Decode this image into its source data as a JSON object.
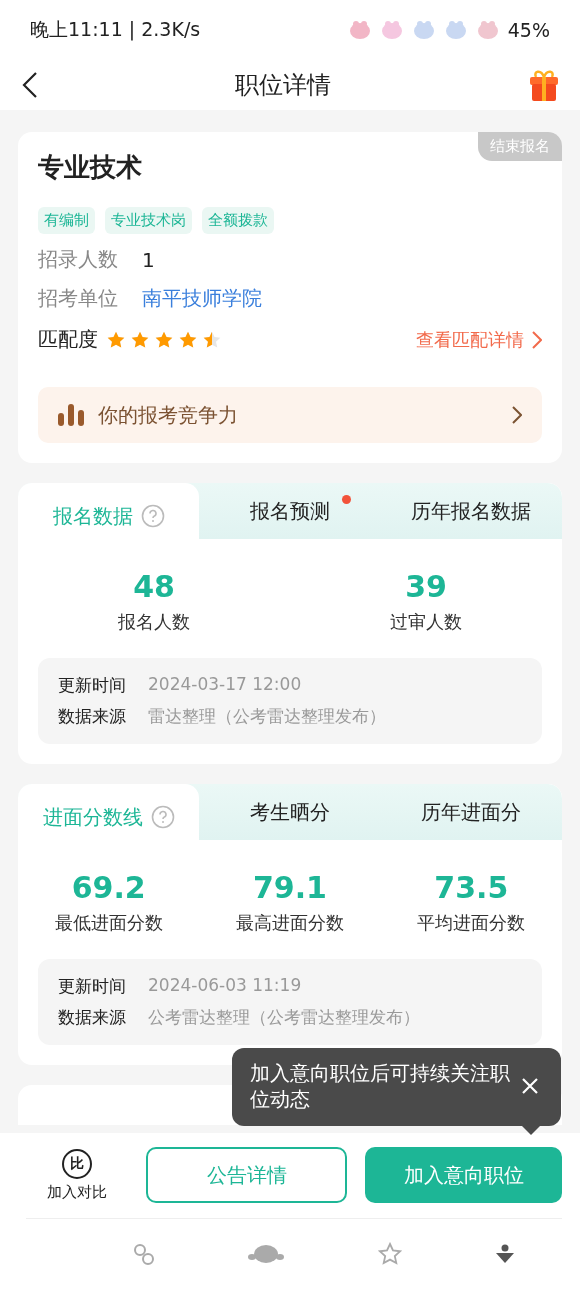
{
  "status_bar": {
    "time": "晚上11:11 | 2.3K/s",
    "battery": "45%"
  },
  "header": {
    "title": "职位详情"
  },
  "job": {
    "title": "专业技术",
    "badge": "结束报名",
    "tags": [
      "有编制",
      "专业技术岗",
      "全额拨款"
    ],
    "fields": [
      {
        "kind": "plain",
        "label": "招录人数",
        "value": "1"
      },
      {
        "kind": "link",
        "label": "招考单位",
        "value": "南平技师学院"
      }
    ],
    "match": {
      "label": "匹配度",
      "stars": 4.5,
      "link": "查看匹配详情"
    },
    "competitiveness": "你的报考竞争力"
  },
  "sections": [
    {
      "tabs": [
        {
          "label": "报名数据",
          "selected": true,
          "help": true,
          "dot": false
        },
        {
          "label": "报名预测",
          "selected": false,
          "help": false,
          "dot": true
        },
        {
          "label": "历年报名数据",
          "selected": false,
          "help": false,
          "dot": false
        }
      ],
      "stats": [
        {
          "value": "48",
          "label": "报名人数"
        },
        {
          "value": "39",
          "label": "过审人数"
        }
      ],
      "info": [
        {
          "label": "更新时间",
          "value": "2024-03-17 12:00"
        },
        {
          "label": "数据来源",
          "value": "雷达整理（公考雷达整理发布）"
        }
      ]
    },
    {
      "tabs": [
        {
          "label": "进面分数线",
          "selected": true,
          "help": true,
          "dot": false
        },
        {
          "label": "考生晒分",
          "selected": false,
          "help": false,
          "dot": false
        },
        {
          "label": "历年进面分",
          "selected": false,
          "help": false,
          "dot": false
        }
      ],
      "stats": [
        {
          "value": "69.2",
          "label": "最低进面分数"
        },
        {
          "value": "79.1",
          "label": "最高进面分数"
        },
        {
          "value": "73.5",
          "label": "平均进面分数"
        }
      ],
      "info": [
        {
          "label": "更新时间",
          "value": "2024-06-03 11:19"
        },
        {
          "label": "数据来源",
          "value": "公考雷达整理（公考雷达整理发布）"
        }
      ]
    }
  ],
  "tooltip": {
    "text": "加入意向职位后可持续关注职位动态"
  },
  "actions": {
    "compare": {
      "icon_text": "比",
      "label": "加入对比"
    },
    "secondary": "公告详情",
    "primary": "加入意向职位"
  }
}
